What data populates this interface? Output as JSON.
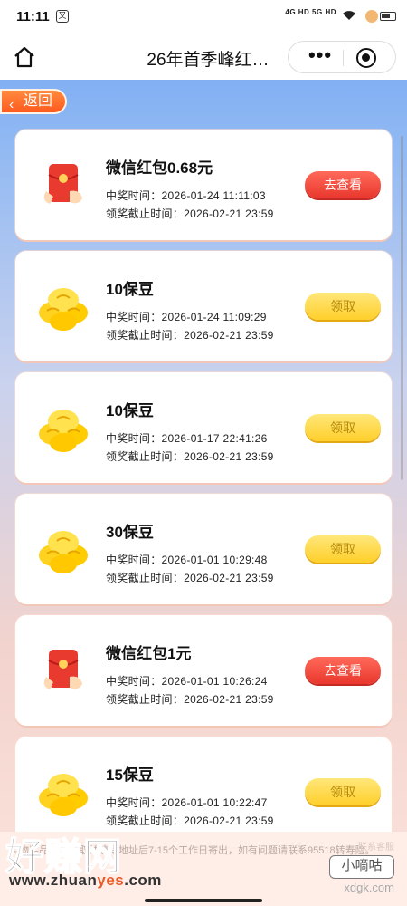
{
  "status_bar": {
    "time": "11:11",
    "app_badge": "叉",
    "network": "4G HD  5G HD"
  },
  "navbar": {
    "title": "26年首季峰红…",
    "more_label": "•••"
  },
  "back_button": {
    "label": "返回"
  },
  "records": [
    {
      "prize": "微信红包0.68元",
      "type": "redpacket",
      "win_time": "中奖时间：2026-01-24 11:11:03",
      "deadline": "领奖截止时间：2026-02-21 23:59",
      "action": "去查看",
      "action_style": "view"
    },
    {
      "prize": "10保豆",
      "type": "coins",
      "win_time": "中奖时间：2026-01-24 11:09:29",
      "deadline": "领奖截止时间：2026-02-21 23:59",
      "action": "领取",
      "action_style": "claim"
    },
    {
      "prize": "10保豆",
      "type": "coins",
      "win_time": "中奖时间：2026-01-17 22:41:26",
      "deadline": "领奖截止时间：2026-02-21 23:59",
      "action": "领取",
      "action_style": "claim"
    },
    {
      "prize": "30保豆",
      "type": "coins",
      "win_time": "中奖时间：2026-01-01 10:29:48",
      "deadline": "领奖截止时间：2026-02-21 23:59",
      "action": "领取",
      "action_style": "claim"
    },
    {
      "prize": "微信红包1元",
      "type": "redpacket",
      "win_time": "中奖时间：2026-01-01 10:26:24",
      "deadline": "领奖截止时间：2026-02-21 23:59",
      "action": "去查看",
      "action_style": "view"
    },
    {
      "prize": "15保豆",
      "type": "coins",
      "win_time": "中奖时间：2026-01-01 10:22:47",
      "deadline": "领奖截止时间：2026-02-21 23:59",
      "action": "领取",
      "action_style": "claim"
    }
  ],
  "notice": {
    "text": "实物奖品需在领取并填写地址后7-15个工作日寄出，如有问题请联系95518转寿险。",
    "side": "联系客服"
  },
  "watermark": {
    "big": "好赚网",
    "url_pre": "www.zhuan",
    "url_accent": "yes",
    "url_post": ".com",
    "right_badge": "小嘀咕",
    "right_url": "xdgk.com"
  },
  "colors": {
    "view_button": "#e9372d",
    "claim_button": "#ffd534",
    "back_button": "#ff5a1f"
  }
}
